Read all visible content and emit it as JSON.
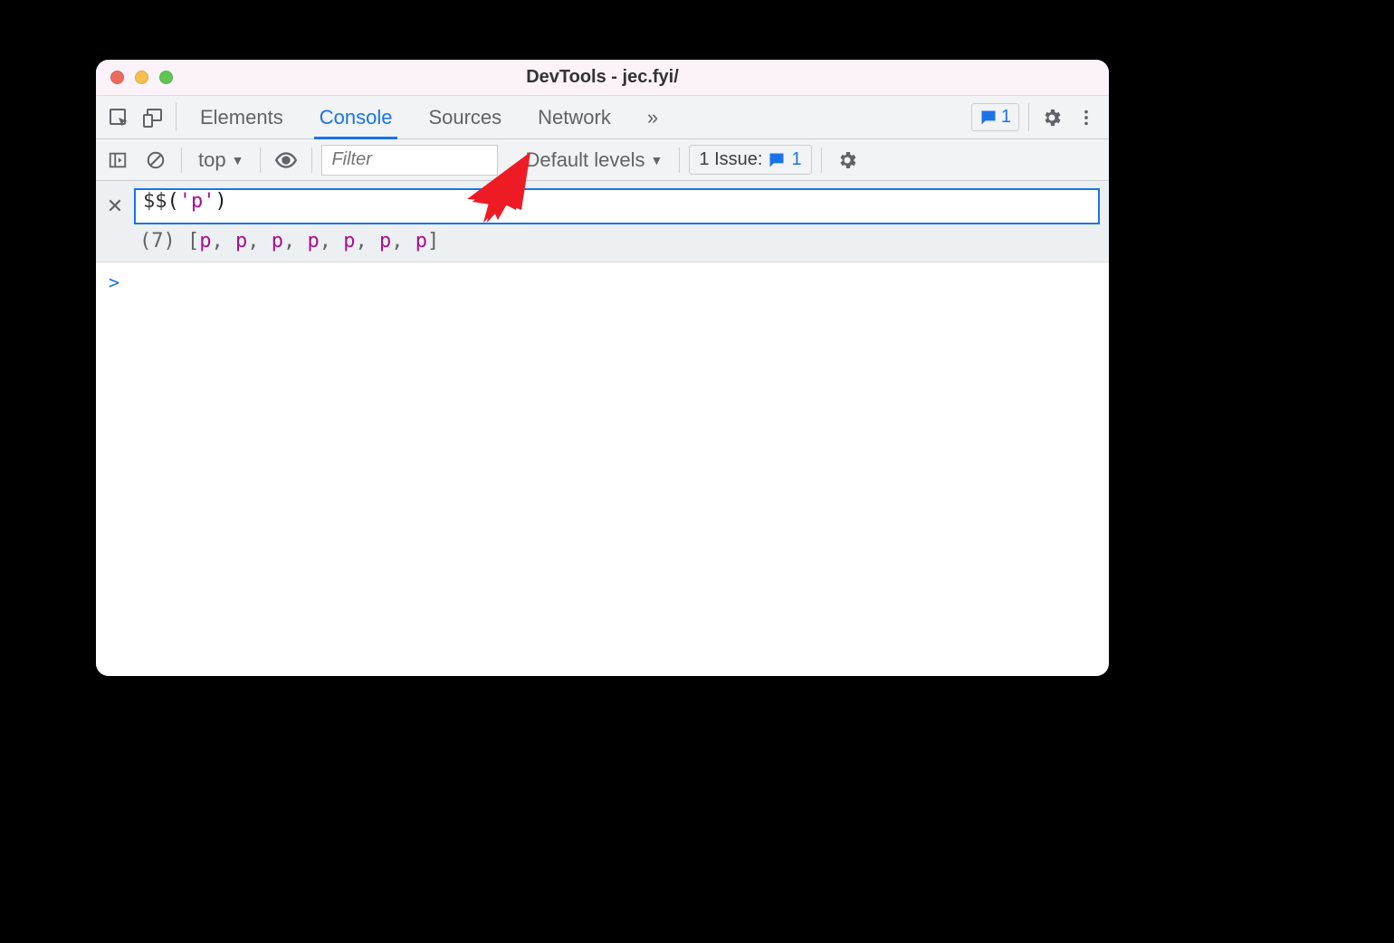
{
  "window": {
    "title": "DevTools - jec.fyi/"
  },
  "tabbar": {
    "tabs": [
      {
        "label": "Elements",
        "active": false
      },
      {
        "label": "Console",
        "active": true
      },
      {
        "label": "Sources",
        "active": false
      },
      {
        "label": "Network",
        "active": false
      }
    ],
    "overflow": "»",
    "feedback_count": "1"
  },
  "toolbar": {
    "context": "top",
    "filter_placeholder": "Filter",
    "levels_label": "Default levels",
    "issues_label": "1 Issue:",
    "issues_count": "1"
  },
  "expression": {
    "func": "$$",
    "open_paren": "(",
    "string": "'p'",
    "close_paren": ")",
    "result_count": "(7)",
    "result_open": " [",
    "result_items": [
      "p",
      "p",
      "p",
      "p",
      "p",
      "p",
      "p"
    ],
    "result_sep": ", ",
    "result_close": "]"
  },
  "prompt": ">"
}
